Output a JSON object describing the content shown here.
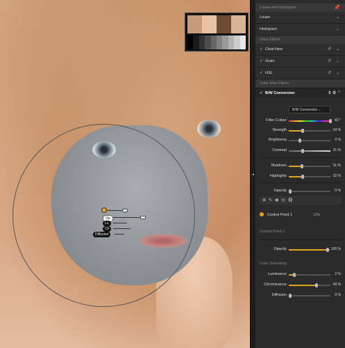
{
  "thumb": {
    "faces": [
      "#c79a78",
      "#e7c3a4",
      "#6d4b34",
      "#d9b497"
    ],
    "bars": [
      "#000",
      "#1a1a1a",
      "#333",
      "#4d4d4d",
      "#666",
      "#808080",
      "#999",
      "#b3b3b3",
      "#ccc",
      "#e6e6e6"
    ]
  },
  "control_point_overlay": {
    "labels": [
      "Op",
      "Lu",
      "Ch",
      "Diffusion"
    ]
  },
  "panel": {
    "loupe_histogram_header": "Loupe and Histogram",
    "loupe_label": "Loupe",
    "histogram_label": "Histogram",
    "dfine_header": "Dfine Filters",
    "clearview_label": "ClearView",
    "grain_label": "Grain",
    "hsl_label": "HSL",
    "color_filters_header": "Color Efex Filters",
    "bw_title": "B/W Conversion",
    "bw_mode": "B/W Conversion",
    "sliders": {
      "filter_colour": {
        "label": "Filter Colour",
        "value": "60 °"
      },
      "strength": {
        "label": "Strength",
        "value": "34 %"
      },
      "brightness": {
        "label": "Brightness",
        "value": "0 %"
      },
      "contrast": {
        "label": "Contrast",
        "value": "31 %"
      },
      "shadows": {
        "label": "Shadows",
        "value": "31 %"
      },
      "highlights": {
        "label": "Highlights",
        "value": "32 %"
      },
      "opacity": {
        "label": "Opacity",
        "value": "0 %"
      },
      "cp_opacity": {
        "label": "Opacity",
        "value": "100 %"
      },
      "luminance": {
        "label": "Luminance",
        "value": "2 %"
      },
      "chrominance": {
        "label": "Chrominance",
        "value": "69 %"
      },
      "diffusion": {
        "label": "Diffusion",
        "value": "0 %"
      }
    },
    "control_point_label": "Control Point 1",
    "control_point_pct": "12%",
    "control_point_section": "Control Point 1",
    "color_selectivity": "Color Selectivity"
  },
  "accent": "#e3a520"
}
